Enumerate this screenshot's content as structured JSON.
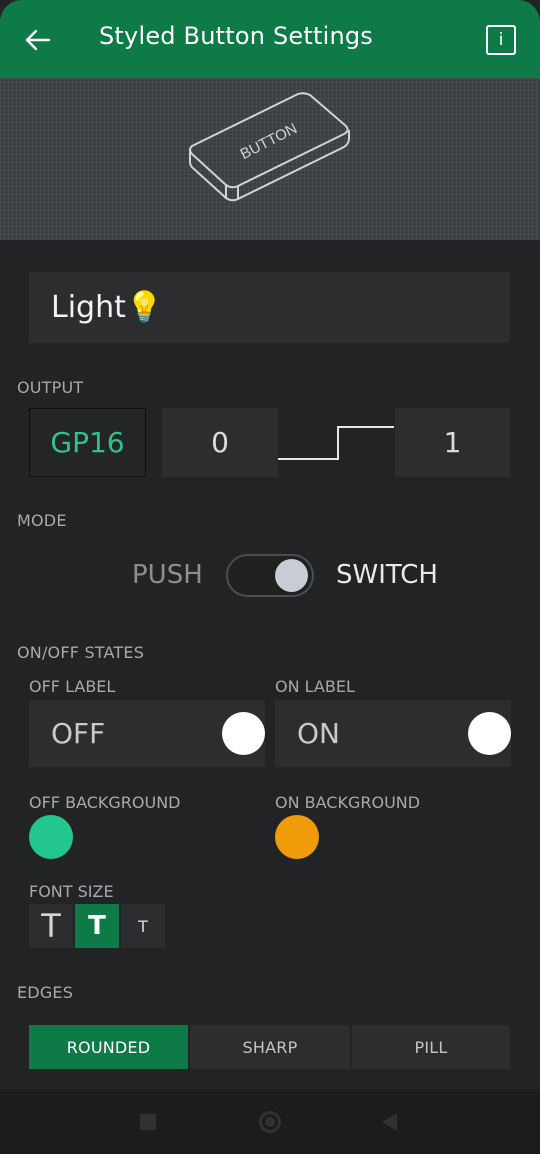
{
  "header": {
    "title": "Styled Button Settings",
    "back_icon": "arrow-left-icon",
    "info_icon": "info-icon",
    "info_glyph": "i"
  },
  "preview": {
    "button_text": "BUTTON"
  },
  "name_field": {
    "value": "Light💡"
  },
  "output": {
    "label": "OUTPUT",
    "pin": "GP16",
    "low_value": "0",
    "high_value": "1"
  },
  "mode": {
    "label": "MODE",
    "left": "PUSH",
    "right": "SWITCH",
    "selected": "SWITCH"
  },
  "states": {
    "label": "ON/OFF STATES",
    "off_label_title": "OFF LABEL",
    "off_label_value": "OFF",
    "on_label_title": "ON LABEL",
    "on_label_value": "ON",
    "off_bg_title": "OFF BACKGROUND",
    "on_bg_title": "ON BACKGROUND",
    "off_bg_color": "#23c78e",
    "on_bg_color": "#f09c0a"
  },
  "font_size": {
    "label": "FONT SIZE",
    "options": [
      "T",
      "T",
      "T"
    ],
    "selected_index": 1
  },
  "edges": {
    "label": "EDGES",
    "options": [
      "ROUNDED",
      "SHARP",
      "PILL"
    ],
    "selected": "ROUNDED"
  },
  "colors": {
    "accent": "#0e7a47",
    "background": "#222324",
    "field": "#2b2d2f"
  }
}
